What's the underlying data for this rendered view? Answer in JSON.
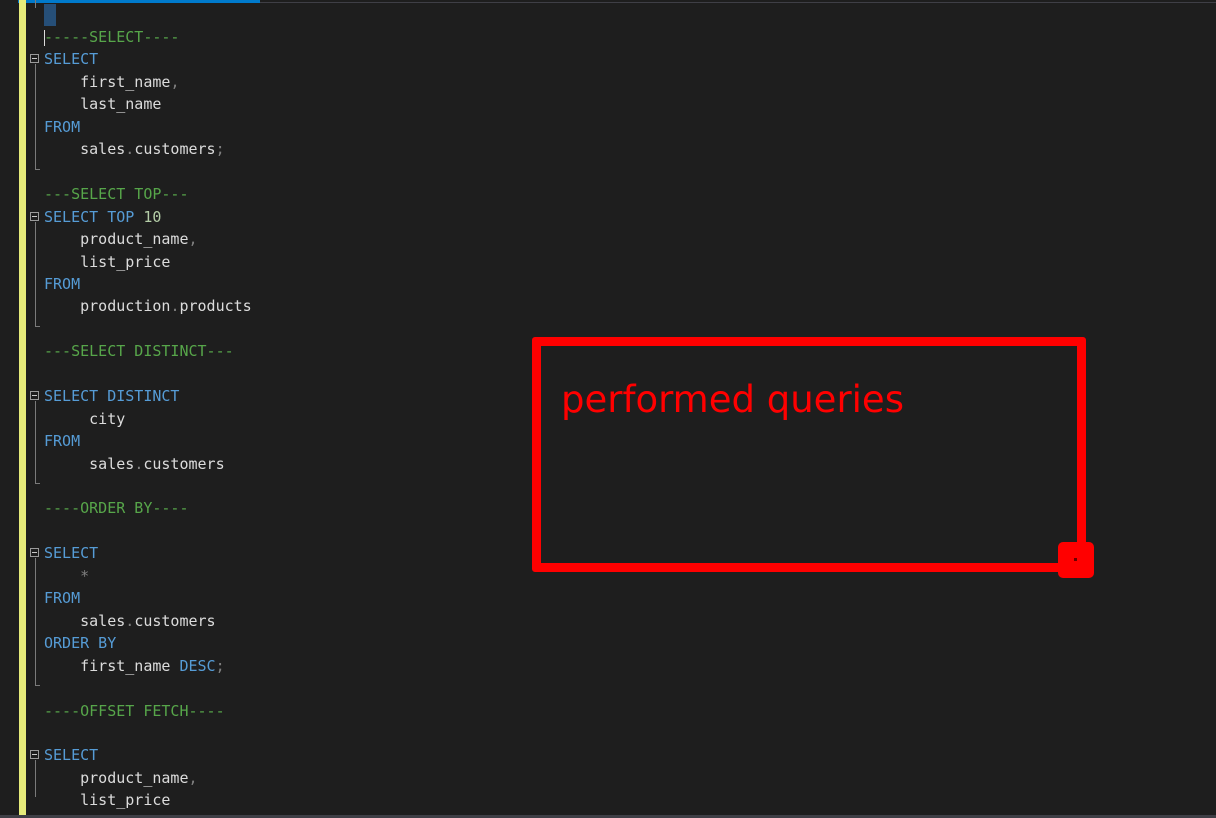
{
  "window": {
    "accent": "#007acc"
  },
  "editor": {
    "lines": [
      {
        "parts": [
          {
            "t": "-----SELECT----",
            "c": "cm"
          }
        ]
      },
      {
        "parts": [
          {
            "t": "SELECT",
            "c": "kw"
          }
        ],
        "fold": true
      },
      {
        "parts": [
          {
            "t": "    first_name",
            "c": "id"
          },
          {
            "t": ",",
            "c": "op"
          }
        ]
      },
      {
        "parts": [
          {
            "t": "    last_name",
            "c": "id"
          }
        ]
      },
      {
        "parts": [
          {
            "t": "FROM",
            "c": "kw"
          }
        ]
      },
      {
        "parts": [
          {
            "t": "    sales",
            "c": "id"
          },
          {
            "t": ".",
            "c": "op"
          },
          {
            "t": "customers",
            "c": "id"
          },
          {
            "t": ";",
            "c": "op"
          }
        ]
      },
      {
        "parts": []
      },
      {
        "parts": [
          {
            "t": "---SELECT TOP---",
            "c": "cm"
          }
        ]
      },
      {
        "parts": [
          {
            "t": "SELECT TOP ",
            "c": "kw"
          },
          {
            "t": "10",
            "c": "num"
          }
        ],
        "fold": true
      },
      {
        "parts": [
          {
            "t": "    product_name",
            "c": "id"
          },
          {
            "t": ",",
            "c": "op"
          }
        ]
      },
      {
        "parts": [
          {
            "t": "    list_price",
            "c": "id"
          }
        ]
      },
      {
        "parts": [
          {
            "t": "FROM",
            "c": "kw"
          }
        ]
      },
      {
        "parts": [
          {
            "t": "    production",
            "c": "id"
          },
          {
            "t": ".",
            "c": "op"
          },
          {
            "t": "products",
            "c": "id"
          }
        ]
      },
      {
        "parts": []
      },
      {
        "parts": [
          {
            "t": "---SELECT DISTINCT---",
            "c": "cm"
          }
        ]
      },
      {
        "parts": []
      },
      {
        "parts": [
          {
            "t": "SELECT DISTINCT",
            "c": "kw"
          }
        ],
        "fold": true
      },
      {
        "parts": [
          {
            "t": "     city",
            "c": "id"
          }
        ]
      },
      {
        "parts": [
          {
            "t": "FROM",
            "c": "kw"
          }
        ]
      },
      {
        "parts": [
          {
            "t": "     sales",
            "c": "id"
          },
          {
            "t": ".",
            "c": "op"
          },
          {
            "t": "customers",
            "c": "id"
          }
        ]
      },
      {
        "parts": []
      },
      {
        "parts": [
          {
            "t": "----ORDER BY----",
            "c": "cm"
          }
        ]
      },
      {
        "parts": []
      },
      {
        "parts": [
          {
            "t": "SELECT",
            "c": "kw"
          }
        ],
        "fold": true
      },
      {
        "parts": [
          {
            "t": "    *",
            "c": "op"
          }
        ]
      },
      {
        "parts": [
          {
            "t": "FROM",
            "c": "kw"
          }
        ]
      },
      {
        "parts": [
          {
            "t": "    sales",
            "c": "id"
          },
          {
            "t": ".",
            "c": "op"
          },
          {
            "t": "customers",
            "c": "id"
          }
        ]
      },
      {
        "parts": [
          {
            "t": "ORDER BY",
            "c": "kw"
          }
        ]
      },
      {
        "parts": [
          {
            "t": "    first_name ",
            "c": "id"
          },
          {
            "t": "DESC",
            "c": "kw"
          },
          {
            "t": ";",
            "c": "op"
          }
        ]
      },
      {
        "parts": []
      },
      {
        "parts": [
          {
            "t": "----OFFSET FETCH----",
            "c": "cm"
          }
        ]
      },
      {
        "parts": []
      },
      {
        "parts": [
          {
            "t": "SELECT",
            "c": "kw"
          }
        ],
        "fold": true
      },
      {
        "parts": [
          {
            "t": "    product_name",
            "c": "id"
          },
          {
            "t": ",",
            "c": "op"
          }
        ]
      },
      {
        "parts": [
          {
            "t": "    list_price",
            "c": "id"
          }
        ]
      }
    ]
  },
  "annotation": {
    "text": "performed queries",
    "color": "#ff0000"
  }
}
